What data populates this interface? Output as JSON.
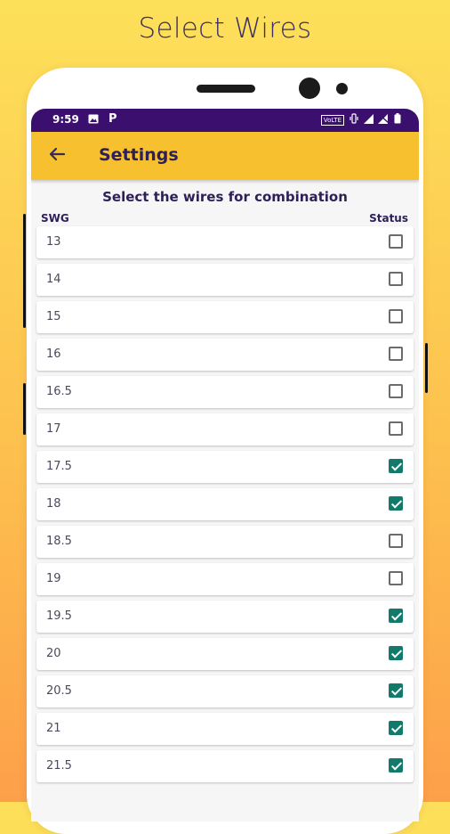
{
  "promo": {
    "title": "Select Wires"
  },
  "status_bar": {
    "time": "9:59",
    "volte": "VoLTE"
  },
  "app_bar": {
    "title": "Settings"
  },
  "subtitle": "Select the wires for combination",
  "columns": {
    "swg": "SWG",
    "status": "Status"
  },
  "colors": {
    "app_bar": "#f6c02f",
    "status_bar": "#3b0f6e",
    "checked": "#127a6a"
  },
  "rows": [
    {
      "label": "13",
      "checked": false
    },
    {
      "label": "14",
      "checked": false
    },
    {
      "label": "15",
      "checked": false
    },
    {
      "label": "16",
      "checked": false
    },
    {
      "label": "16.5",
      "checked": false
    },
    {
      "label": "17",
      "checked": false
    },
    {
      "label": "17.5",
      "checked": true
    },
    {
      "label": "18",
      "checked": true
    },
    {
      "label": "18.5",
      "checked": false
    },
    {
      "label": "19",
      "checked": false
    },
    {
      "label": "19.5",
      "checked": true
    },
    {
      "label": "20",
      "checked": true
    },
    {
      "label": "20.5",
      "checked": true
    },
    {
      "label": "21",
      "checked": true
    },
    {
      "label": "21.5",
      "checked": true
    }
  ]
}
